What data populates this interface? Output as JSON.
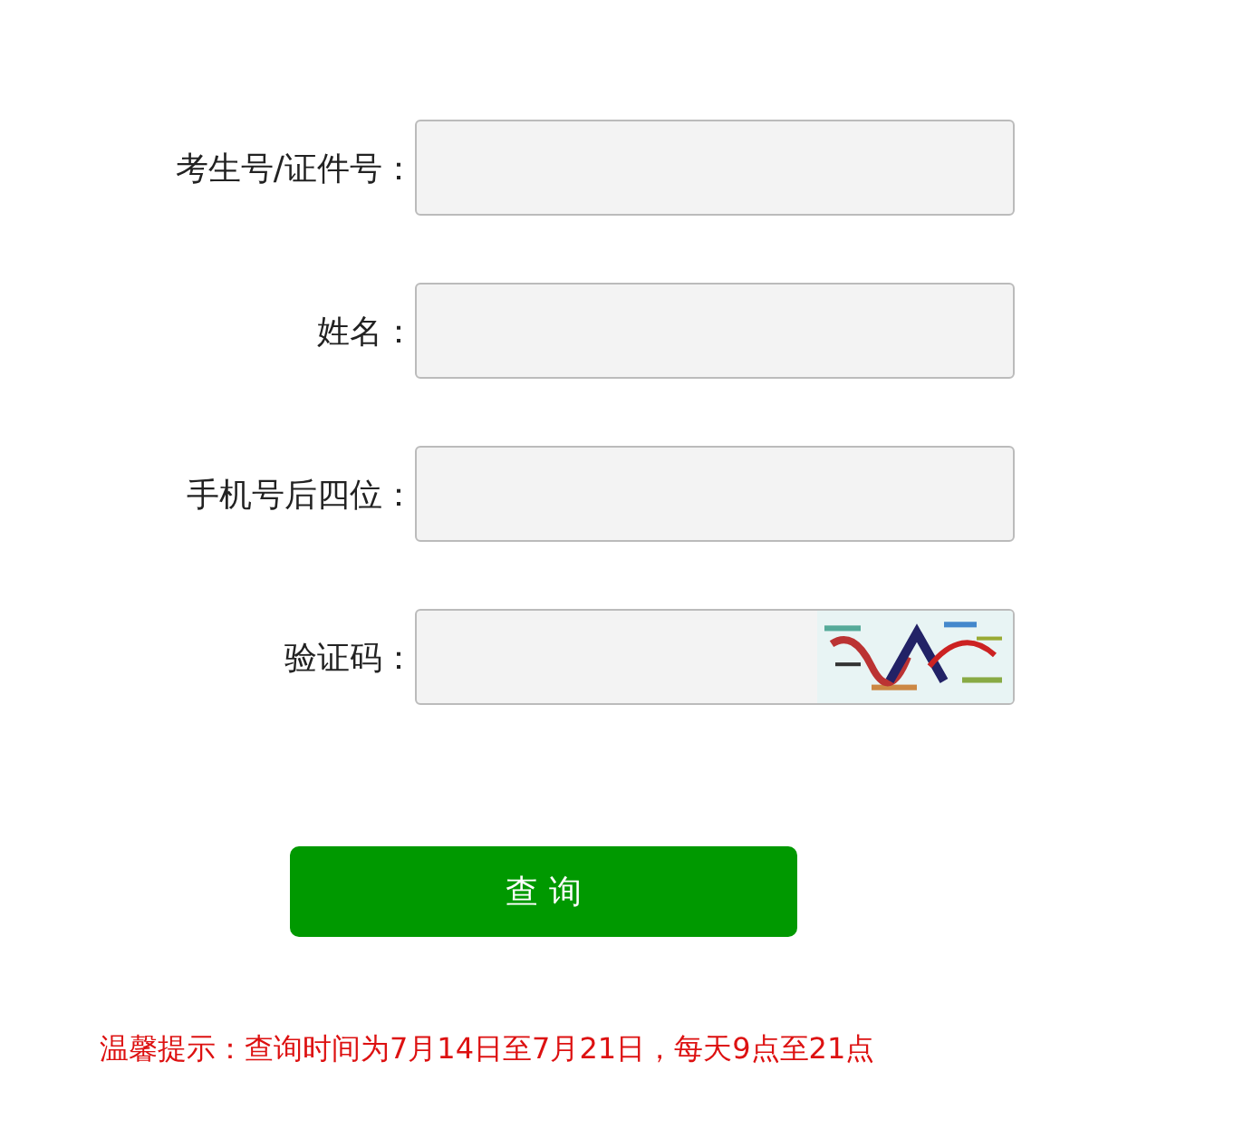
{
  "fields": [
    {
      "label": "考生号/证件号：",
      "kind": "text"
    },
    {
      "label": "姓名：",
      "kind": "text"
    },
    {
      "label": "手机号后四位：",
      "kind": "text"
    },
    {
      "label": "验证码：",
      "kind": "captcha"
    }
  ],
  "submit": "查 询",
  "notice": "温馨提示：查询时间为7月14日至7月21日，每天9点至21点"
}
